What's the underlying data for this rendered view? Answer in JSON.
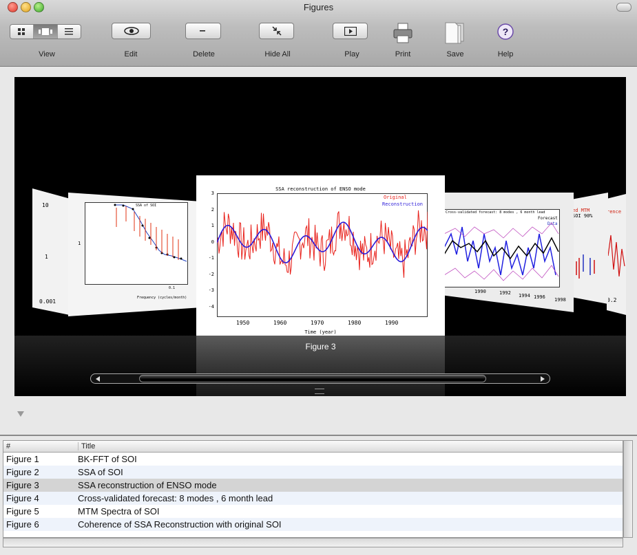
{
  "window": {
    "title": "Figures"
  },
  "toolbar": {
    "view_label": "View",
    "edit_label": "Edit",
    "delete_label": "Delete",
    "hide_all_label": "Hide All",
    "play_label": "Play",
    "print_label": "Print",
    "save_label": "Save",
    "help_label": "Help",
    "view_modes": [
      "grid-view-icon",
      "coverflow-view-icon",
      "list-view-icon"
    ],
    "selected_view": "coverflow-view-icon"
  },
  "coverflow": {
    "selected_caption": "Figure 3",
    "center_figure": {
      "title": "SSA reconstruction of ENSO mode",
      "xlabel": "Time (year)",
      "x_ticks": [
        "1950",
        "1960",
        "1970",
        "1980",
        "1990"
      ],
      "y_ticks": [
        "3",
        "2",
        "1",
        "0",
        "-1",
        "-2",
        "-3",
        "-4"
      ],
      "legend": [
        {
          "name": "Original",
          "color": "#e8201a"
        },
        {
          "name": "Reconstruction",
          "color": "#2a1ad8"
        }
      ]
    },
    "left_figure": {
      "title": "SSA of SOI",
      "xlabel": "Frequency (cycles/month)",
      "y_ticks": [
        "10",
        "1",
        "0.001"
      ],
      "x_ticks": [
        "0.1"
      ]
    },
    "right_figure": {
      "title": "Cross-validated forecast: 8 modes , 6 month lead",
      "legend": [
        "Forecast",
        "Data"
      ],
      "x_ticks": [
        "1990",
        "1992",
        "1994",
        "1996",
        "1998"
      ]
    },
    "far_right_labels": [
      "ed MTM",
      "SOI 90%",
      "rence",
      "0.2"
    ]
  },
  "table": {
    "columns": [
      "#",
      "Title"
    ],
    "rows": [
      {
        "num": "Figure 1",
        "title": "BK-FFT of SOI"
      },
      {
        "num": "Figure 2",
        "title": "SSA of SOI"
      },
      {
        "num": "Figure 3",
        "title": "SSA reconstruction of ENSO mode"
      },
      {
        "num": "Figure 4",
        "title": "Cross-validated forecast: 8 modes , 6 month lead"
      },
      {
        "num": "Figure 5",
        "title": "MTM Spectra of SOI"
      },
      {
        "num": "Figure 6",
        "title": "Coherence of SSA Reconstruction with original SOI"
      }
    ],
    "selected_row": 3
  }
}
